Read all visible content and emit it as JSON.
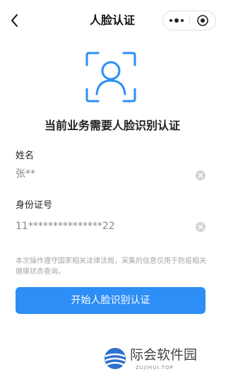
{
  "header": {
    "title": "人脸认证",
    "back_icon": "chevron-left-icon",
    "more_icon": "more-dots-icon",
    "close_icon": "record-circle-icon"
  },
  "main": {
    "face_icon": "face-scan-icon",
    "prompt": "当前业务需要人脸识别认证",
    "accent_color": "#2d8ef5",
    "fields": [
      {
        "label": "姓名",
        "value": "张**"
      },
      {
        "label": "身份证号",
        "value": "11***************22"
      }
    ],
    "notice": "本次操作遵守国家相关法律法规，采集的信息仅用于防疫相关健康状态查询。",
    "start_button": "开始人脸识别认证"
  },
  "watermark": {
    "name": "际会软件园",
    "sub": "ZUJIHUI.TOP"
  }
}
